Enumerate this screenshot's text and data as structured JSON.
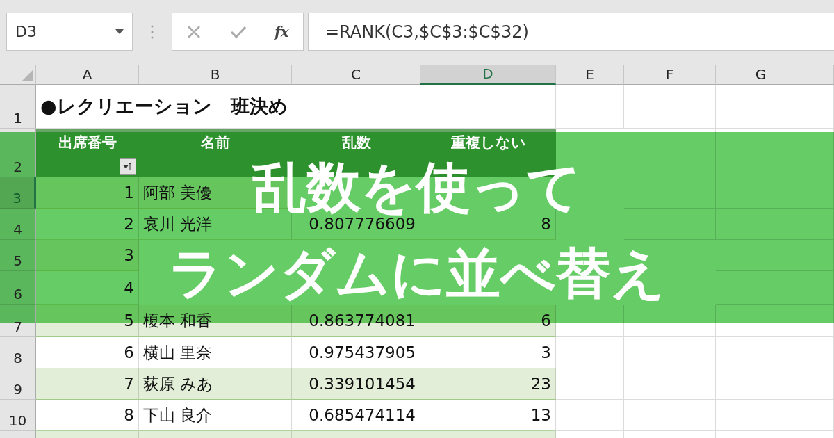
{
  "name_box": {
    "value": "D3"
  },
  "formula_bar": {
    "function_button": "fx",
    "value": "=RANK(C3,$C$3:$C$32)"
  },
  "columns": [
    {
      "label": "A",
      "selected": false
    },
    {
      "label": "B",
      "selected": false
    },
    {
      "label": "C",
      "selected": false
    },
    {
      "label": "D",
      "selected": true
    },
    {
      "label": "E",
      "selected": false
    },
    {
      "label": "F",
      "selected": false
    },
    {
      "label": "G",
      "selected": false
    }
  ],
  "row_headers": [
    {
      "label": "1",
      "selected": false
    },
    {
      "label": "2",
      "selected": false
    },
    {
      "label": "3",
      "selected": true
    },
    {
      "label": "4",
      "selected": false
    },
    {
      "label": "5",
      "selected": false
    },
    {
      "label": "6",
      "selected": false
    },
    {
      "label": "7",
      "selected": false
    },
    {
      "label": "8",
      "selected": false
    },
    {
      "label": "9",
      "selected": false
    },
    {
      "label": "10",
      "selected": false
    }
  ],
  "title": "●レクリエーション　班決め",
  "table": {
    "headers": [
      {
        "text": "出席番号",
        "kind": "sort"
      },
      {
        "text": "名前",
        "kind": "plain"
      },
      {
        "text": "乱数",
        "kind": "plain"
      },
      {
        "text": "重複しない",
        "kind": "plain"
      }
    ],
    "rows": [
      {
        "number": "1",
        "name": "阿部 美優"
      },
      {
        "number": "2",
        "name": "哀川 光洋",
        "random": "0.807776609",
        "rank": "8"
      },
      {
        "number": "3"
      },
      {
        "number": "4"
      },
      {
        "number": "5",
        "name": "榎本 和香",
        "random": "0.863774081",
        "rank": "6"
      },
      {
        "number": "6",
        "name": "横山 里奈",
        "random": "0.975437905",
        "rank": "3"
      },
      {
        "number": "7",
        "name": "荻原 みあ",
        "random": "0.339101454",
        "rank": "23"
      },
      {
        "number": "8",
        "name": "下山 良介",
        "random": "0.685474114",
        "rank": "13"
      }
    ]
  },
  "banner": {
    "lines": [
      "乱数を使って",
      "ランダムに並べ替え"
    ]
  }
}
